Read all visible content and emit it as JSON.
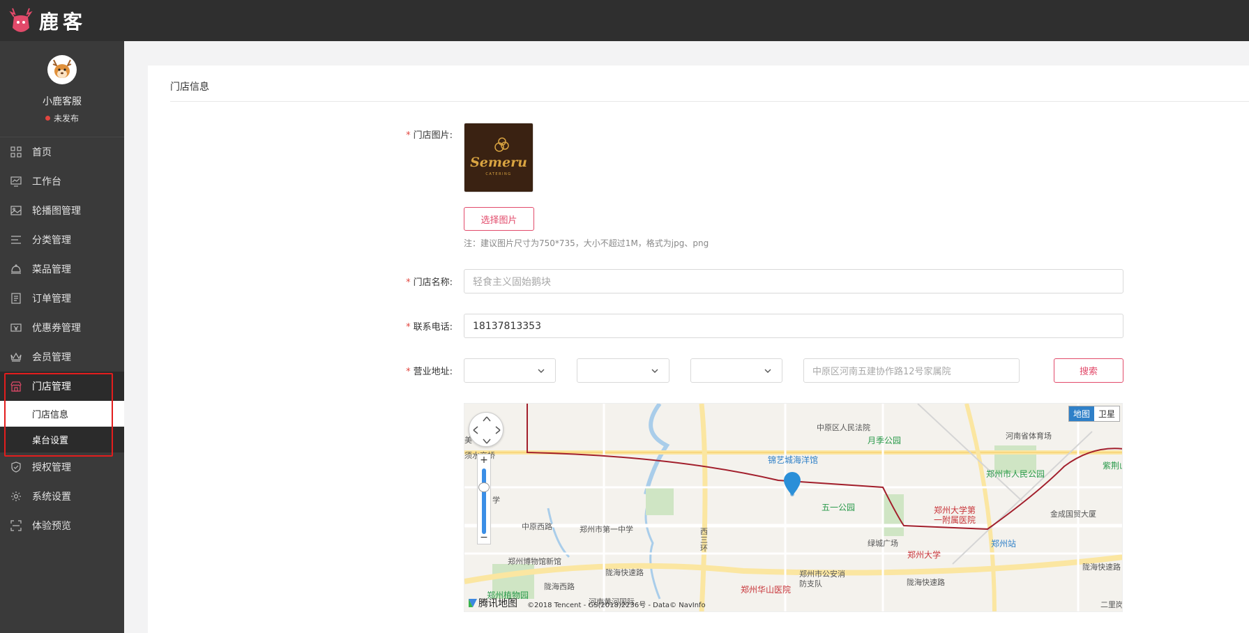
{
  "app": {
    "brand": "鹿客"
  },
  "profile": {
    "name": "小鹿客服",
    "status": "未发布"
  },
  "menu": {
    "items": [
      {
        "label": "首页",
        "icon": "grid-icon"
      },
      {
        "label": "工作台",
        "icon": "monitor-chart-icon"
      },
      {
        "label": "轮播图管理",
        "icon": "image-icon"
      },
      {
        "label": "分类管理",
        "icon": "list-icon"
      },
      {
        "label": "菜品管理",
        "icon": "cloche-icon"
      },
      {
        "label": "订单管理",
        "icon": "document-icon"
      },
      {
        "label": "优惠券管理",
        "icon": "coupon-icon"
      },
      {
        "label": "会员管理",
        "icon": "crown-icon"
      },
      {
        "label": "门店管理",
        "icon": "store-icon"
      },
      {
        "label": "授权管理",
        "icon": "shield-check-icon"
      },
      {
        "label": "系统设置",
        "icon": "gear-icon"
      },
      {
        "label": "体验预览",
        "icon": "scan-icon"
      }
    ],
    "submenu": [
      {
        "label": "门店信息"
      },
      {
        "label": "桌台设置"
      }
    ]
  },
  "panel": {
    "title": "门店信息"
  },
  "form": {
    "image_label": "门店图片:",
    "choose_image_label": "选择图片",
    "image_hint": "注：建议图片尺寸为750*735，大小不超过1M，格式为jpg、png",
    "store_logo_text": "Semeru",
    "store_logo_sub": "CATERING",
    "name_label": "门店名称:",
    "name_placeholder": "轻食主义固始鹅块",
    "phone_label": "联系电话:",
    "phone_value": "18137813353",
    "address_label": "营业地址:",
    "address_placeholder": "中原区河南五建协作路12号家属院",
    "search_label": "搜索",
    "required_mark": "*"
  },
  "map": {
    "toggle_map": "地图",
    "toggle_satellite": "卫星",
    "brand": "腾讯地图",
    "copyright": "©2018 Tencent - GS(2018)2236号 - Data© NavInfo",
    "labels": {
      "court": "中原区人民法院",
      "moon_park": "月季公园",
      "sports": "河南省体育场",
      "ocean": "锦艺城海洋馆",
      "people_park": "郑州市人民公园",
      "zijing": "紫荆山",
      "bridge": "须水交桥",
      "wuyi": "五一公园",
      "hospital1": "郑州大学第一附属医院",
      "jincheng": "金成国贸大厦",
      "zhongyuan": "中原西路",
      "school": "郑州市第一中学",
      "xihuan": "西三环",
      "greencity": "绿城广场",
      "zzu": "郑州大学",
      "station": "郑州站",
      "museum": "郑州博物馆新馆",
      "longhai1": "陇海快速路",
      "longhai2": "陇海快速路",
      "longhai3": "陇海快速路",
      "police": "郑州市公安消防支队",
      "huashan": "郑州华山医院",
      "botanic": "郑州植物园",
      "longhaixi": "陇海西路",
      "school2": "学",
      "erli": "二里岗",
      "huanghe": "河南黄河国际",
      "mei": "美"
    }
  }
}
